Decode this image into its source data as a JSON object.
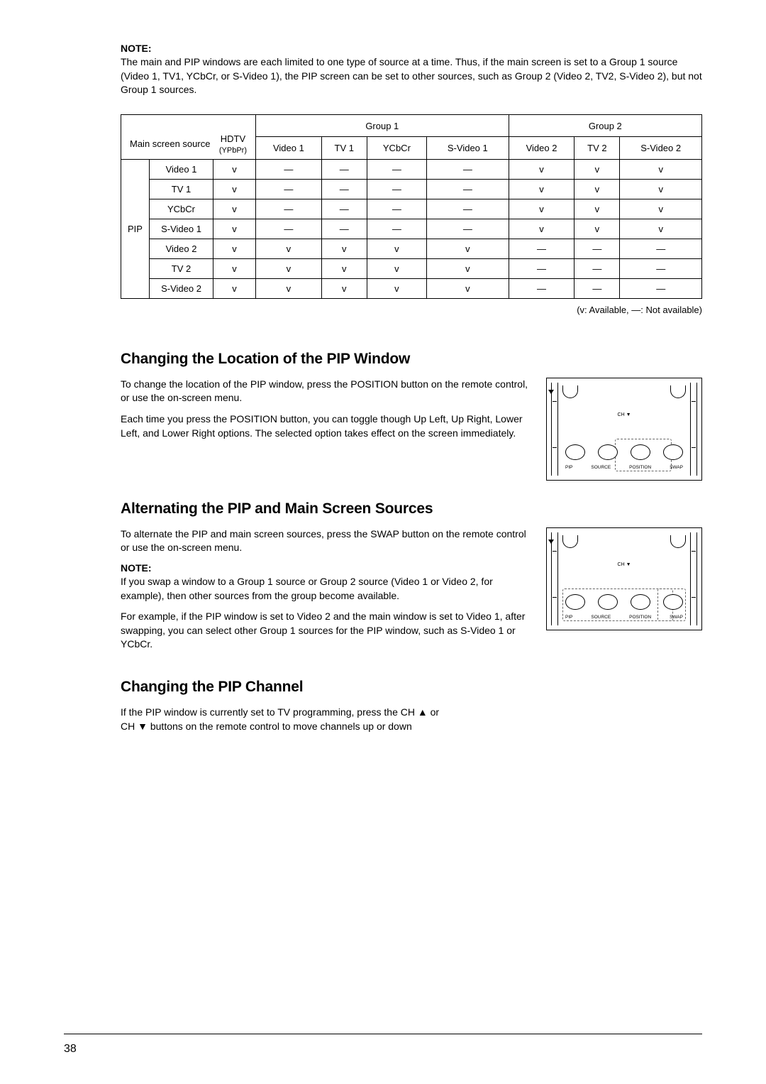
{
  "note1": {
    "label": "NOTE:",
    "text": "The main and PIP windows are each limited to one type of source at a time. Thus, if the main screen is set to a Group 1 source (Video 1, TV1, YCbCr, or S-Video 1), the PIP screen can be set to other sources, such as Group 2 (Video 2, TV2, S-Video 2), but not Group 1 sources."
  },
  "table": {
    "group1": "Group 1",
    "group2": "Group 2",
    "main_source": "Main screen source",
    "hdtv": "HDTV",
    "ypbpr": "(YPbPr)",
    "cols": [
      "Video 1",
      "TV 1",
      "YCbCr",
      "S-Video 1",
      "Video 2",
      "TV 2",
      "S-Video 2"
    ],
    "pip": "PIP",
    "rows": [
      {
        "name": "Video 1",
        "h": "v",
        "c": [
          "—",
          "—",
          "—",
          "—",
          "v",
          "v",
          "v"
        ]
      },
      {
        "name": "TV 1",
        "h": "v",
        "c": [
          "—",
          "—",
          "—",
          "—",
          "v",
          "v",
          "v"
        ]
      },
      {
        "name": "YCbCr",
        "h": "v",
        "c": [
          "—",
          "—",
          "—",
          "—",
          "v",
          "v",
          "v"
        ]
      },
      {
        "name": "S-Video 1",
        "h": "v",
        "c": [
          "—",
          "—",
          "—",
          "—",
          "v",
          "v",
          "v"
        ]
      },
      {
        "name": "Video 2",
        "h": "v",
        "c": [
          "v",
          "v",
          "v",
          "v",
          "—",
          "—",
          "—"
        ]
      },
      {
        "name": "TV 2",
        "h": "v",
        "c": [
          "v",
          "v",
          "v",
          "v",
          "—",
          "—",
          "—"
        ]
      },
      {
        "name": "S-Video 2",
        "h": "v",
        "c": [
          "v",
          "v",
          "v",
          "v",
          "—",
          "—",
          "—"
        ]
      }
    ]
  },
  "legend": "(v: Available, —: Not available)",
  "sec1": {
    "title": "Changing the Location of the PIP Window",
    "p1": "To change the location of the PIP window, press the POSITION button on the remote control, or use the on-screen menu.",
    "p2": "Each time you press the POSITION button, you can toggle though Up Left, Up Right, Lower Left, and Lower Right options. The selected option takes effect on the screen immediately."
  },
  "sec2": {
    "title": "Alternating the PIP and Main Screen Sources",
    "p1": "To alternate the PIP and main screen sources, press the SWAP button on the remote control or use the on-screen menu.",
    "note_label": "NOTE:",
    "note_text": "If you swap a window to a Group 1 source or Group 2 source (Video 1 or Video 2, for example), then other sources from the group become available.",
    "p2": "For example, if the PIP window is set to Video 2 and the main window is set to Video 1, after swapping, you can select other Group 1 sources for the PIP window, such as S-Video 1 or YCbCr."
  },
  "sec3": {
    "title": "Changing the PIP Channel",
    "p1": "If the PIP window is currently set to TV programming, press the CH ▲ or CH ▼ buttons on the remote control to move channels up or down"
  },
  "remote": {
    "ch_label": "CH ▼",
    "btns": [
      "PIP",
      "SOURCE",
      "POSITION",
      "SWAP"
    ]
  },
  "page": "38"
}
